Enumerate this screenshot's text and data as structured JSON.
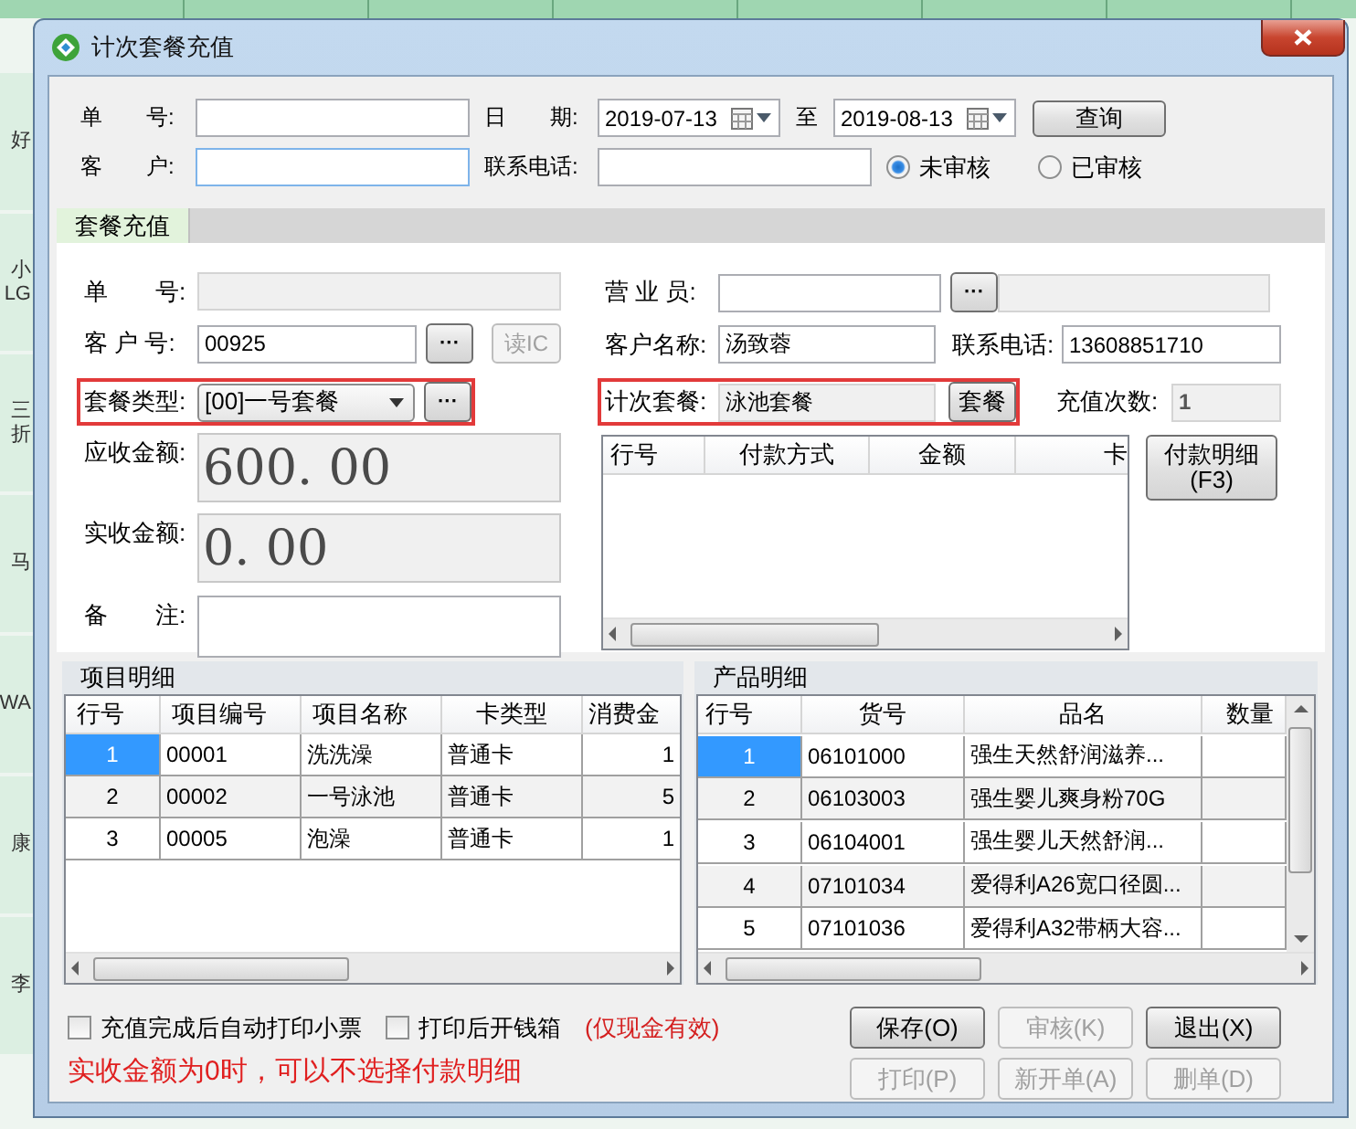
{
  "background": {
    "side_cards": [
      {
        "labels": [
          "好"
        ]
      },
      {
        "labels": [
          "小",
          "LG"
        ]
      },
      {
        "labels": [
          "三",
          "折"
        ]
      },
      {
        "labels": [
          "马"
        ]
      },
      {
        "labels": [
          "WA"
        ]
      },
      {
        "labels": [
          "康"
        ]
      },
      {
        "labels": [
          "李"
        ]
      }
    ]
  },
  "window": {
    "title": "计次套餐充值"
  },
  "query": {
    "order_label": "单　　号:",
    "date_label": "日　　期:",
    "date_from": "2019-07-13",
    "to_label": "至",
    "date_to": "2019-08-13",
    "query_button": "查询",
    "customer_label": "客　　户:",
    "phone_label": "联系电话:",
    "status_options": [
      {
        "label": "未审核",
        "selected": true
      },
      {
        "label": "已审核",
        "selected": false
      }
    ]
  },
  "tabs": [
    {
      "label": "套餐充值",
      "selected": true
    }
  ],
  "form": {
    "order_no": {
      "label": "单　　号:"
    },
    "customer_no": {
      "label": "客 户 号:",
      "value": "00925",
      "browse_button": "···",
      "read_ic_button": {
        "label": "读IC",
        "disabled": true
      }
    },
    "package_type": {
      "label": "套餐类型:",
      "value": "[00]一号套餐",
      "browse_button": "···",
      "highlighted": true
    },
    "receivable": {
      "label": "应收金额:",
      "value": "600. 00"
    },
    "received": {
      "label": "实收金额:",
      "value": "0. 00"
    },
    "remark": {
      "label": "备　　注:"
    },
    "salesperson": {
      "label": "营 业 员:",
      "browse_button": "···"
    },
    "customer_name": {
      "label": "客户名称:",
      "value": "汤致蓉"
    },
    "phone": {
      "label": "联系电话:",
      "value": "13608851710"
    },
    "count_package": {
      "label": "计次套餐:",
      "value": "泳池套餐",
      "button": "套餐",
      "highlighted": true
    },
    "recharge_times": {
      "label": "充值次数:",
      "value": "1"
    },
    "payments": {
      "columns": [
        "行号",
        "付款方式",
        "金额",
        "卡"
      ]
    },
    "payment_detail_button": {
      "label": "付款明细",
      "hotkey": "(F3)"
    }
  },
  "items": {
    "title": "项目明细",
    "columns": [
      "行号",
      "项目编号",
      "项目名称",
      "卡类型",
      "消费金"
    ],
    "rows": [
      {
        "cells": [
          "1",
          "00001",
          "洗洗澡",
          "普通卡",
          "1"
        ],
        "selected": true
      },
      {
        "cells": [
          "2",
          "00002",
          "一号泳池",
          "普通卡",
          "5"
        ],
        "selected": false
      },
      {
        "cells": [
          "3",
          "00005",
          "泡澡",
          "普通卡",
          "1"
        ],
        "selected": false
      }
    ]
  },
  "products": {
    "title": "产品明细",
    "columns": [
      "行号",
      "货号",
      "品名",
      "数量"
    ],
    "rows": [
      {
        "cells": [
          "1",
          "06101000",
          "强生天然舒润滋养..."
        ],
        "selected": true
      },
      {
        "cells": [
          "2",
          "06103003",
          "强生婴儿爽身粉70G"
        ],
        "selected": false
      },
      {
        "cells": [
          "3",
          "06104001",
          "强生婴儿天然舒润..."
        ],
        "selected": false
      },
      {
        "cells": [
          "4",
          "07101034",
          "爱得利A26宽口径圆..."
        ],
        "selected": false
      },
      {
        "cells": [
          "5",
          "07101036",
          "爱得利A32带柄大容..."
        ],
        "selected": false
      }
    ]
  },
  "options": [
    {
      "label": "充值完成后自动打印小票",
      "checked": false
    },
    {
      "label": "打印后开钱箱",
      "checked": false
    }
  ],
  "cash_note": "(仅现金有效)",
  "warning": "实收金额为0时，可以不选择付款明细",
  "buttons": [
    {
      "label": "保存(O)",
      "disabled": false
    },
    {
      "label": "审核(K)",
      "disabled": true
    },
    {
      "label": "退出(X)",
      "disabled": false
    },
    {
      "label": "打印(P)",
      "disabled": true
    },
    {
      "label": "新开单(A)",
      "disabled": true
    },
    {
      "label": "删单(D)",
      "disabled": true
    }
  ]
}
